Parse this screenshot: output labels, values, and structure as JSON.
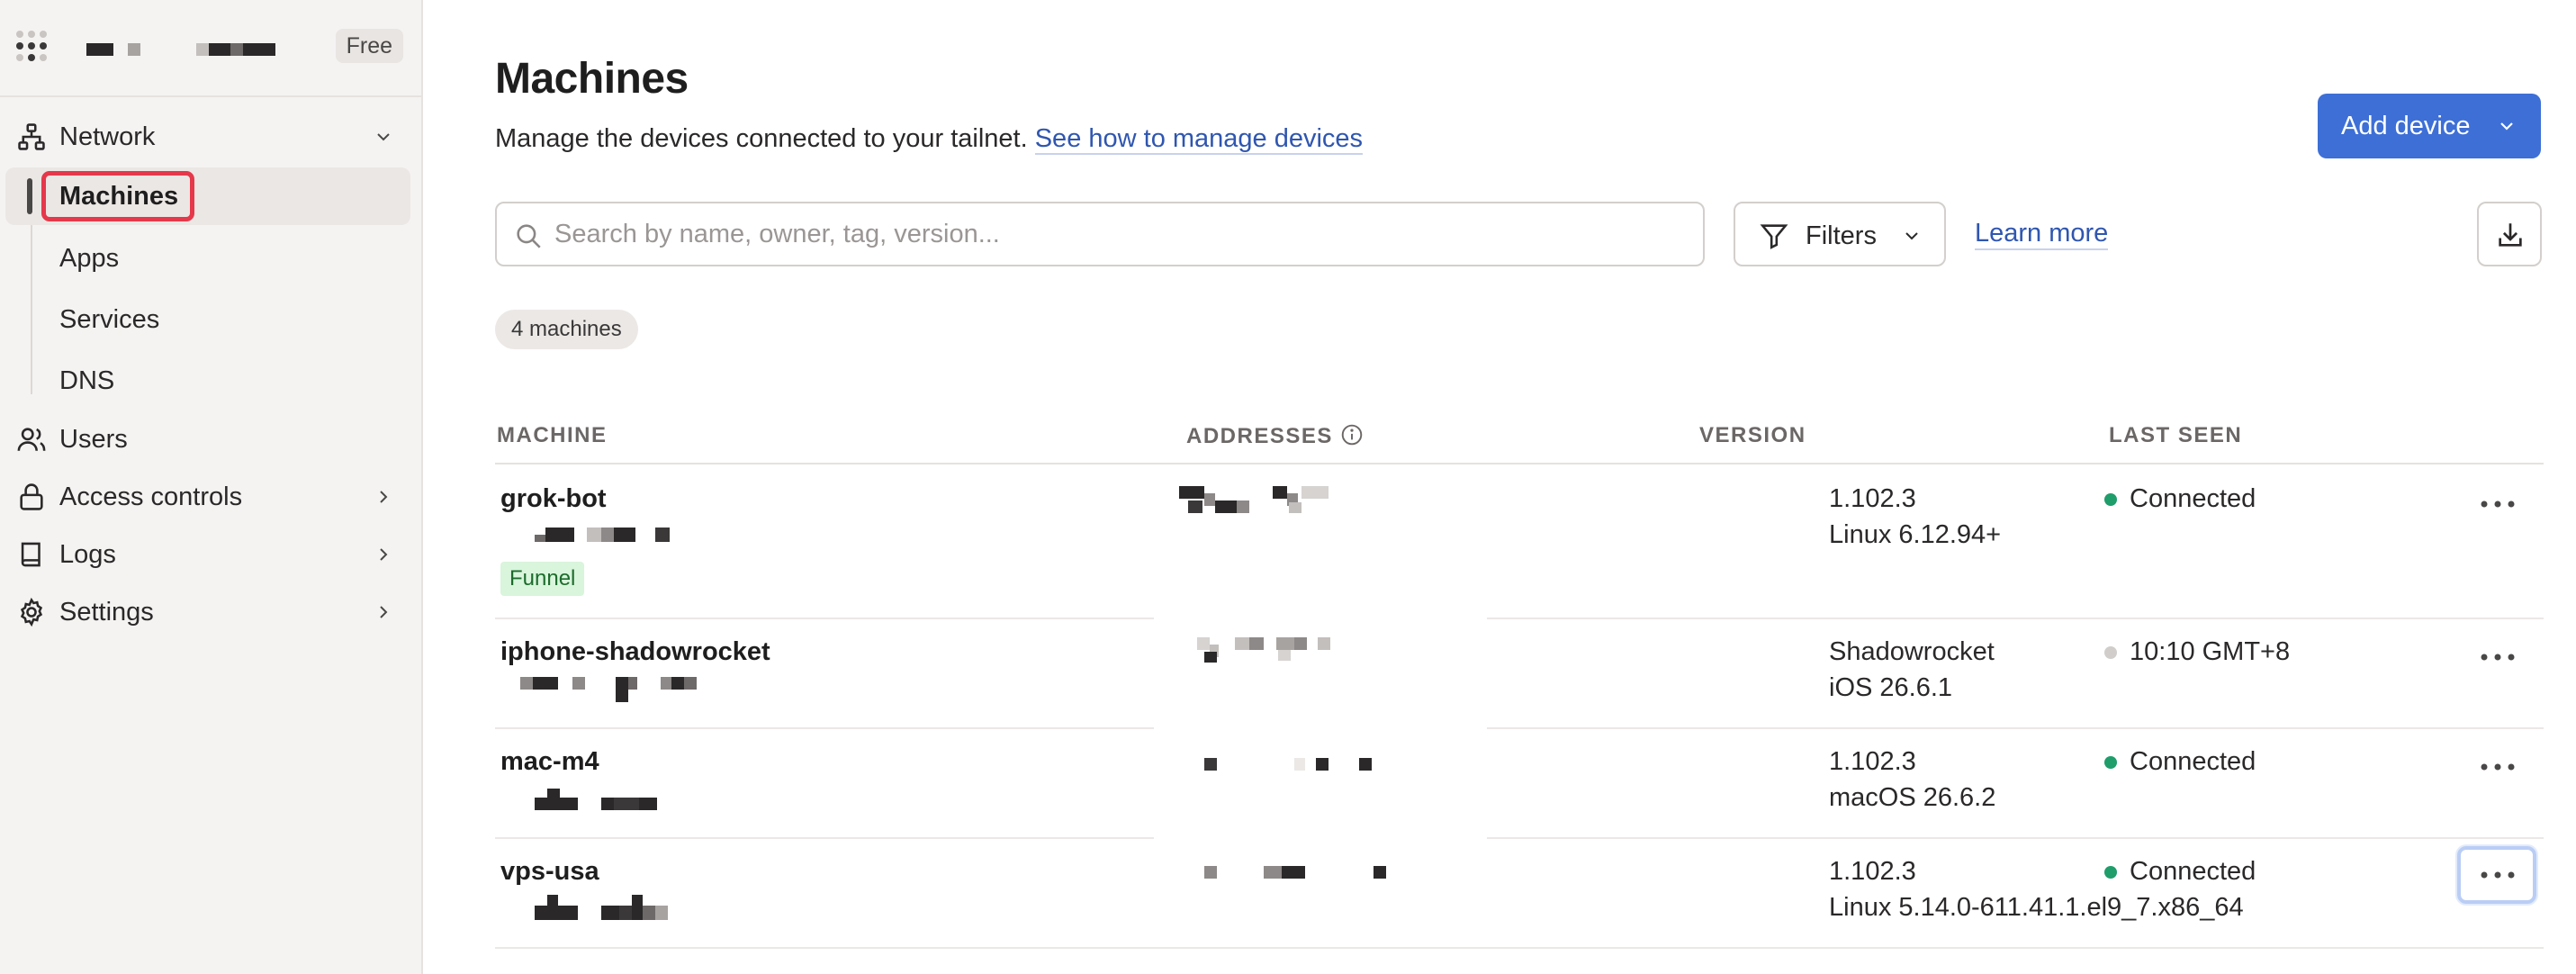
{
  "sidebar": {
    "plan_badge": "Free",
    "nav": [
      {
        "label": "Network",
        "icon": "network-icon",
        "expanded": true
      },
      {
        "label": "Users",
        "icon": "users-icon"
      },
      {
        "label": "Access controls",
        "icon": "lock-icon"
      },
      {
        "label": "Logs",
        "icon": "book-icon"
      },
      {
        "label": "Settings",
        "icon": "gear-icon"
      }
    ],
    "network_sub": [
      "Machines",
      "Apps",
      "Services",
      "DNS"
    ],
    "active_item": "Machines"
  },
  "page": {
    "title": "Machines",
    "description": "Manage the devices connected to your tailnet.",
    "description_link": "See how to manage devices",
    "add_device_label": "Add device"
  },
  "toolbar": {
    "search_placeholder": "Search by name, owner, tag, version...",
    "filters_label": "Filters",
    "learn_more": "Learn more"
  },
  "machine_count": "4 machines",
  "table": {
    "headers": {
      "machine": "MACHINE",
      "addresses": "ADDRESSES",
      "version": "VERSION",
      "last_seen": "LAST SEEN"
    },
    "rows": [
      {
        "name": "grok-bot",
        "tag": "Funnel",
        "version": "1.102.3",
        "os": "Linux 6.12.94+",
        "status": "Connected",
        "status_color": "#1f9d6b"
      },
      {
        "name": "iphone-shadowrocket",
        "version": "Shadowrocket",
        "os": "iOS 26.6.1",
        "status": "10:10 GMT+8",
        "status_color": "#d0cdcb"
      },
      {
        "name": "mac-m4",
        "version": "1.102.3",
        "os": "macOS 26.6.2",
        "status": "Connected",
        "status_color": "#1f9d6b"
      },
      {
        "name": "vps-usa",
        "version": "1.102.3",
        "os": "Linux 5.14.0-611.41.1.el9_7.x86_64",
        "status": "Connected",
        "status_color": "#1f9d6b"
      }
    ]
  },
  "colors": {
    "accent": "#3d6fd6",
    "active_outline": "#e5384a",
    "link": "#2f56b0"
  }
}
